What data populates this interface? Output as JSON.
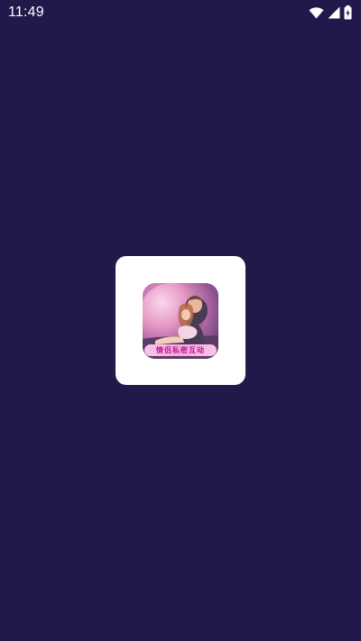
{
  "status_bar": {
    "time": "11:49",
    "icons": [
      "wifi-icon",
      "cellular-signal-icon",
      "battery-charging-icon"
    ]
  },
  "splash": {
    "app_logo_text": "情侣私密互动"
  },
  "colors": {
    "background": "#22194b",
    "card": "#ffffff",
    "logo_text": "#c0168a"
  }
}
